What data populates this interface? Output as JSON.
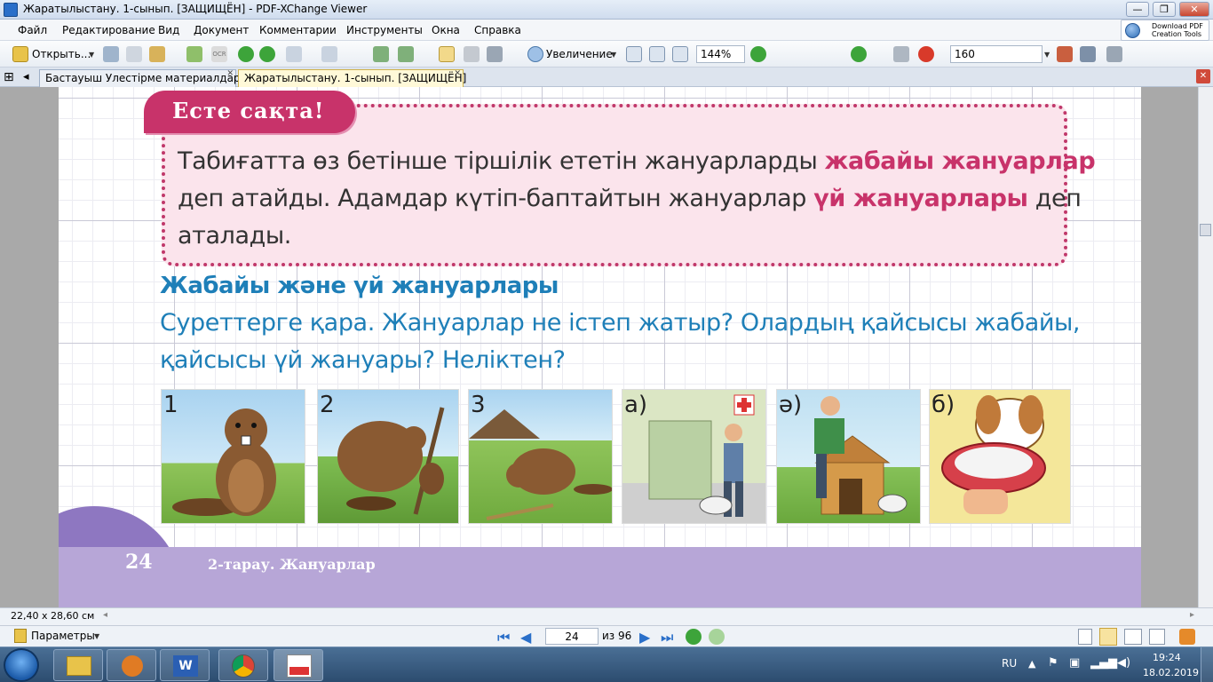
{
  "window": {
    "title": "Жаратылыстану. 1-сынып. [ЗАЩИЩЁН] - PDF-XChange Viewer",
    "btn_min": "—",
    "btn_max": "❐",
    "btn_close": "✕"
  },
  "menu": [
    "Файл",
    "Редактирование",
    "Вид",
    "Документ",
    "Комментарии",
    "Инструменты",
    "Окна",
    "Справка"
  ],
  "download": {
    "line1": "Download PDF",
    "line2": "Creation Tools"
  },
  "toolbar": {
    "open_label": "Открыть...",
    "zoom_label": "Увеличение",
    "zoom_value": "144%",
    "size_value": "160"
  },
  "tabs": [
    {
      "label": "Бастауыш Улестірме материалдар",
      "active": false
    },
    {
      "label": "Жаратылыстану. 1-сынып. [ЗАЩИЩЁН]",
      "active": true
    }
  ],
  "document": {
    "remember_tag": "Есте сақта!",
    "box_lines": [
      {
        "pre": "Табиғатта өз бетінше тіршілік ететін жануарларды ",
        "bold": "жабайы жануарлар",
        "post": ""
      },
      {
        "pre": "деп атайды. Адамдар күтіп-баптайтын жануарлар ",
        "bold": "үй жануарлары",
        "post": " деп"
      },
      {
        "pre": "аталады.",
        "bold": "",
        "post": ""
      }
    ],
    "section_title": "Жабайы және үй жануарлары",
    "question_lines": [
      "Суреттерге қара. Жануарлар не істеп жатыр? Олардың қайсысы жабайы,",
      "қайсысы үй жануары? Неліктен?"
    ],
    "pictures": [
      {
        "label": "1",
        "icon": "beaver-standing"
      },
      {
        "label": "2",
        "icon": "beaver-gnawing"
      },
      {
        "label": "3",
        "icon": "beaver-building"
      },
      {
        "label": "а)",
        "icon": "man-walking-dog"
      },
      {
        "label": "ә)",
        "icon": "man-building-doghouse"
      },
      {
        "label": "б)",
        "icon": "dog-with-bowl"
      }
    ],
    "page_number": "24",
    "chapter": "2-тарау.  Жануарлар"
  },
  "status": {
    "page_size": "22,40 x 28,60 см"
  },
  "nav": {
    "params_label": "Параметры",
    "page_input": "24",
    "of_label": "из 96"
  },
  "tray": {
    "lang": "RU",
    "time": "19:24",
    "date": "18.02.2019"
  },
  "colors": {
    "accent_pink": "#c8336a",
    "heading_blue": "#1e7fb8",
    "footer_purple": "#b7a6d7"
  }
}
